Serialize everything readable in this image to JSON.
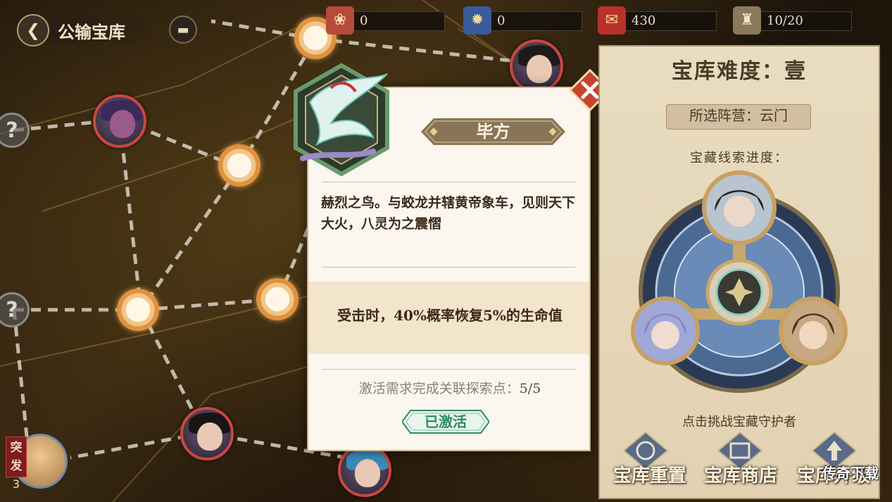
{
  "header": {
    "title": "公输宝库",
    "back_icon": "back-arrow-icon",
    "chat_icon": "chat-icon"
  },
  "resources": [
    {
      "icon": "fan-icon",
      "value": "0"
    },
    {
      "icon": "spirit-orb-icon",
      "value": "0"
    },
    {
      "icon": "scroll-token-icon",
      "value": "430"
    },
    {
      "icon": "gourd-icon",
      "value": "10/20"
    }
  ],
  "card": {
    "name": "毕方",
    "emblem_icon": "crane-emblem-icon",
    "description": "赫烈之鸟。与蛟龙并辖黄帝象车，见则天下大火，八灵为之震慴",
    "effect": "受击时，40%概率恢复5%的生命值",
    "requirement_label": "激活需求完成关联探索点：",
    "requirement_value": "5/5",
    "status": "已激活",
    "close_icon": "close-icon",
    "accent": "#2f8b63"
  },
  "panel": {
    "title": "宝库难度：壹",
    "camp": "所选阵营：云门",
    "clue_label": "宝藏线索进度：",
    "challenge_hint": "点击挑战宝藏守护者",
    "buttons": [
      {
        "label": "宝库重置",
        "icon": "reset-icon"
      },
      {
        "label": "宝库商店",
        "icon": "shop-icon"
      },
      {
        "label": "宝库升级",
        "icon": "upgrade-icon"
      }
    ]
  },
  "raid": {
    "tag": "突发",
    "count": "3"
  },
  "watermark": "传奇下载",
  "colors": {
    "node": "#e0923e",
    "enemy_ring": "#c8483e",
    "panel_bg": "#e9dcc0"
  }
}
